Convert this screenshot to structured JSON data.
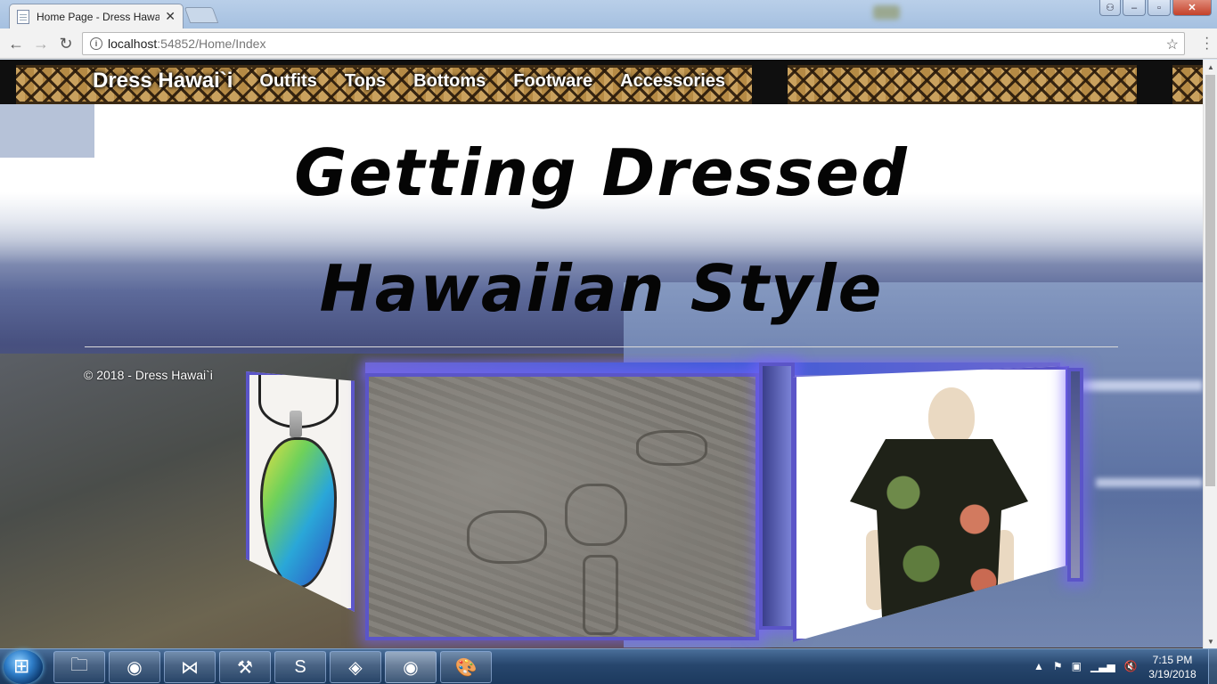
{
  "browser": {
    "tab_title": "Home Page - Dress Hawa",
    "tab_close": "✕",
    "url_host": "localhost",
    "url_path": ":54852/Home/Index"
  },
  "site": {
    "brand": "Dress Hawai`i",
    "nav": [
      "Outfits",
      "Tops",
      "Bottoms",
      "Footware",
      "Accessories"
    ],
    "headline_line1": "Getting Dressed",
    "headline_line2": "Hawaiian Style",
    "footer": "© 2018 - Dress Hawai`i"
  },
  "taskbar": {
    "time": "7:15 PM",
    "date": "3/19/2018"
  },
  "icons": {
    "back": "arrow-left-icon",
    "forward": "arrow-right-icon",
    "reload": "reload-icon",
    "info": "info-icon",
    "star": "star-icon",
    "menu": "kebab-menu-icon"
  },
  "colors": {
    "navbar_bg": "#0f0f0f",
    "headline": "#050505",
    "frame_glow": "#5b55c8",
    "taskbar": "#27466d"
  }
}
